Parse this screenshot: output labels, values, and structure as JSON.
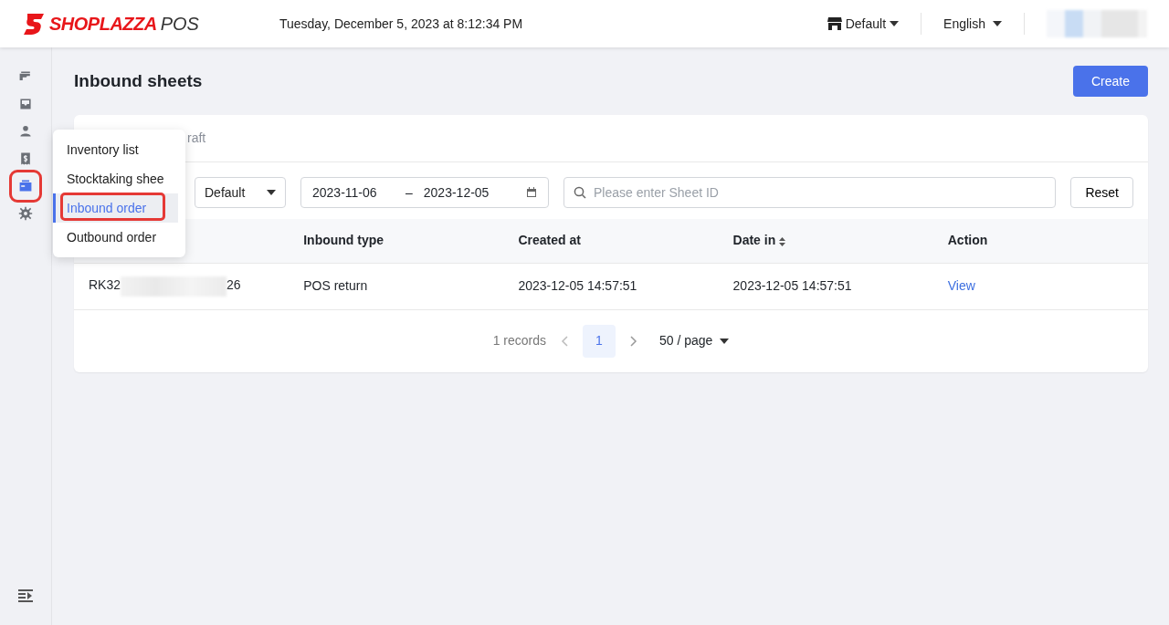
{
  "header": {
    "brand": "SHOPLAZZA",
    "brand_suffix": "POS",
    "datetime": "Tuesday, December 5, 2023 at 8:12:34 PM",
    "store": "Default",
    "language": "English"
  },
  "sidebar": {
    "items": [
      {
        "selected": false
      },
      {
        "selected": false
      },
      {
        "selected": false
      },
      {
        "selected": false
      },
      {
        "selected": true
      },
      {
        "selected": false
      }
    ]
  },
  "menu": {
    "items": [
      {
        "label": "Inventory list",
        "selected": false
      },
      {
        "label": "Stocktaking shee",
        "selected": false
      },
      {
        "label": "Inbound order",
        "selected": true
      },
      {
        "label": "Outbound order",
        "selected": false
      }
    ]
  },
  "page": {
    "title": "Inbound sheets",
    "create_button": "Create"
  },
  "tabs": [
    {
      "label": "raft",
      "selected": false
    }
  ],
  "filters": {
    "type_select": "Default",
    "date_start": "2023-11-06",
    "date_separator": "–",
    "date_end": "2023-12-05",
    "search_placeholder": "Please enter Sheet ID",
    "reset_button": "Reset"
  },
  "table": {
    "columns": [
      "",
      "Inbound type",
      "Created at",
      "Date in",
      "Action"
    ],
    "rows": [
      {
        "id_start": "RK32",
        "id_end": "26",
        "inbound_type": "POS return",
        "created_at": "2023-12-05 14:57:51",
        "date_in": "2023-12-05 14:57:51",
        "action": "View"
      }
    ]
  },
  "pagination": {
    "total": "1 records",
    "pages": [
      {
        "label": "1",
        "selected": true
      }
    ],
    "page_size": "50 / page"
  }
}
